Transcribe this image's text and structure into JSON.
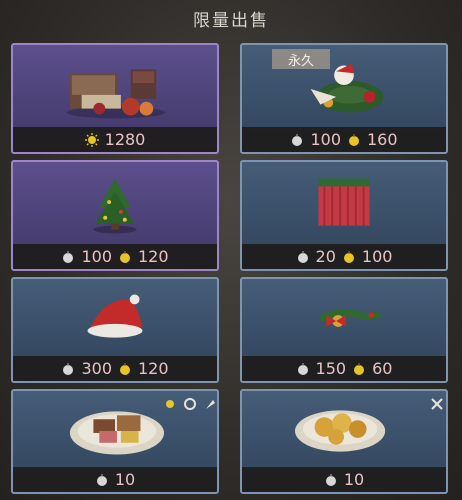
{
  "header": {
    "title": "限量出售"
  },
  "cards": [
    {
      "name": "bed-set",
      "style": "purple",
      "tag": "",
      "prices": [
        {
          "icon": "sun-coin-icon",
          "amount": "1280"
        }
      ]
    },
    {
      "name": "xmas-wreath",
      "style": "blue",
      "tag": "永久",
      "prices": [
        {
          "icon": "silver-apple-icon",
          "amount": "100"
        },
        {
          "icon": "gold-apple-icon",
          "amount": "160"
        }
      ]
    },
    {
      "name": "xmas-tree",
      "style": "purple",
      "tag": "",
      "prices": [
        {
          "icon": "silver-apple-icon",
          "amount": "100"
        },
        {
          "icon": "gold-apple-icon",
          "amount": "120"
        }
      ]
    },
    {
      "name": "red-curtain",
      "style": "blue",
      "tag": "",
      "prices": [
        {
          "icon": "silver-apple-icon",
          "amount": "20"
        },
        {
          "icon": "gold-apple-icon",
          "amount": "100"
        }
      ]
    },
    {
      "name": "santa-hat",
      "style": "blue",
      "tag": "",
      "prices": [
        {
          "icon": "silver-apple-icon",
          "amount": "300"
        },
        {
          "icon": "gold-apple-icon",
          "amount": "120"
        }
      ]
    },
    {
      "name": "xmas-garland",
      "style": "blue",
      "tag": "",
      "prices": [
        {
          "icon": "silver-apple-icon",
          "amount": "150"
        },
        {
          "icon": "gold-apple-icon",
          "amount": "60"
        }
      ]
    },
    {
      "name": "cake-platter",
      "style": "blue",
      "tag": "",
      "prices": [
        {
          "icon": "silver-apple-icon",
          "amount": "10"
        }
      ]
    },
    {
      "name": "cookie-platter",
      "style": "blue",
      "tag": "",
      "prices": [
        {
          "icon": "silver-apple-icon",
          "amount": "10"
        }
      ]
    }
  ],
  "colors": {
    "purple_border": "#9c86c8",
    "blue_border": "#7d95b0",
    "price_text": "#e8c3c3",
    "gold": "#e6c52a"
  }
}
